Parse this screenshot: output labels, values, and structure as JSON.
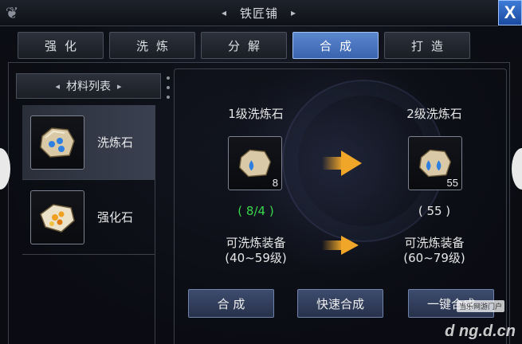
{
  "window": {
    "title": "铁匠铺",
    "close_label": "X"
  },
  "tabs": [
    {
      "label": "强化",
      "active": false
    },
    {
      "label": "洗炼",
      "active": false
    },
    {
      "label": "分解",
      "active": false
    },
    {
      "label": "合成",
      "active": true
    },
    {
      "label": "打造",
      "active": false
    }
  ],
  "material_list": {
    "header": "材料列表",
    "items": [
      {
        "name": "洗炼石",
        "icon": "washing-stone-icon",
        "selected": true
      },
      {
        "name": "强化石",
        "icon": "enhance-stone-icon",
        "selected": false
      }
    ]
  },
  "craft": {
    "source": {
      "title": "1级洗炼石",
      "count": "8",
      "requirement": "( 8/4 )",
      "equip_label": "可洗炼装备",
      "equip_range": "(40~59级)"
    },
    "target": {
      "title": "2级洗炼石",
      "count": "55",
      "amount": "( 55 )",
      "equip_label": "可洗炼装备",
      "equip_range": "(60~79级)"
    }
  },
  "buttons": {
    "combine": "合 成",
    "quick_combine": "快速合成",
    "one_click_combine": "一键合成"
  },
  "watermark": {
    "small": "当乐网游门户",
    "logo": "d ng.d.cn"
  },
  "colors": {
    "active_tab": "#4a76bf",
    "requirement_ok": "#38d64b",
    "arrow": "#f0a628"
  }
}
